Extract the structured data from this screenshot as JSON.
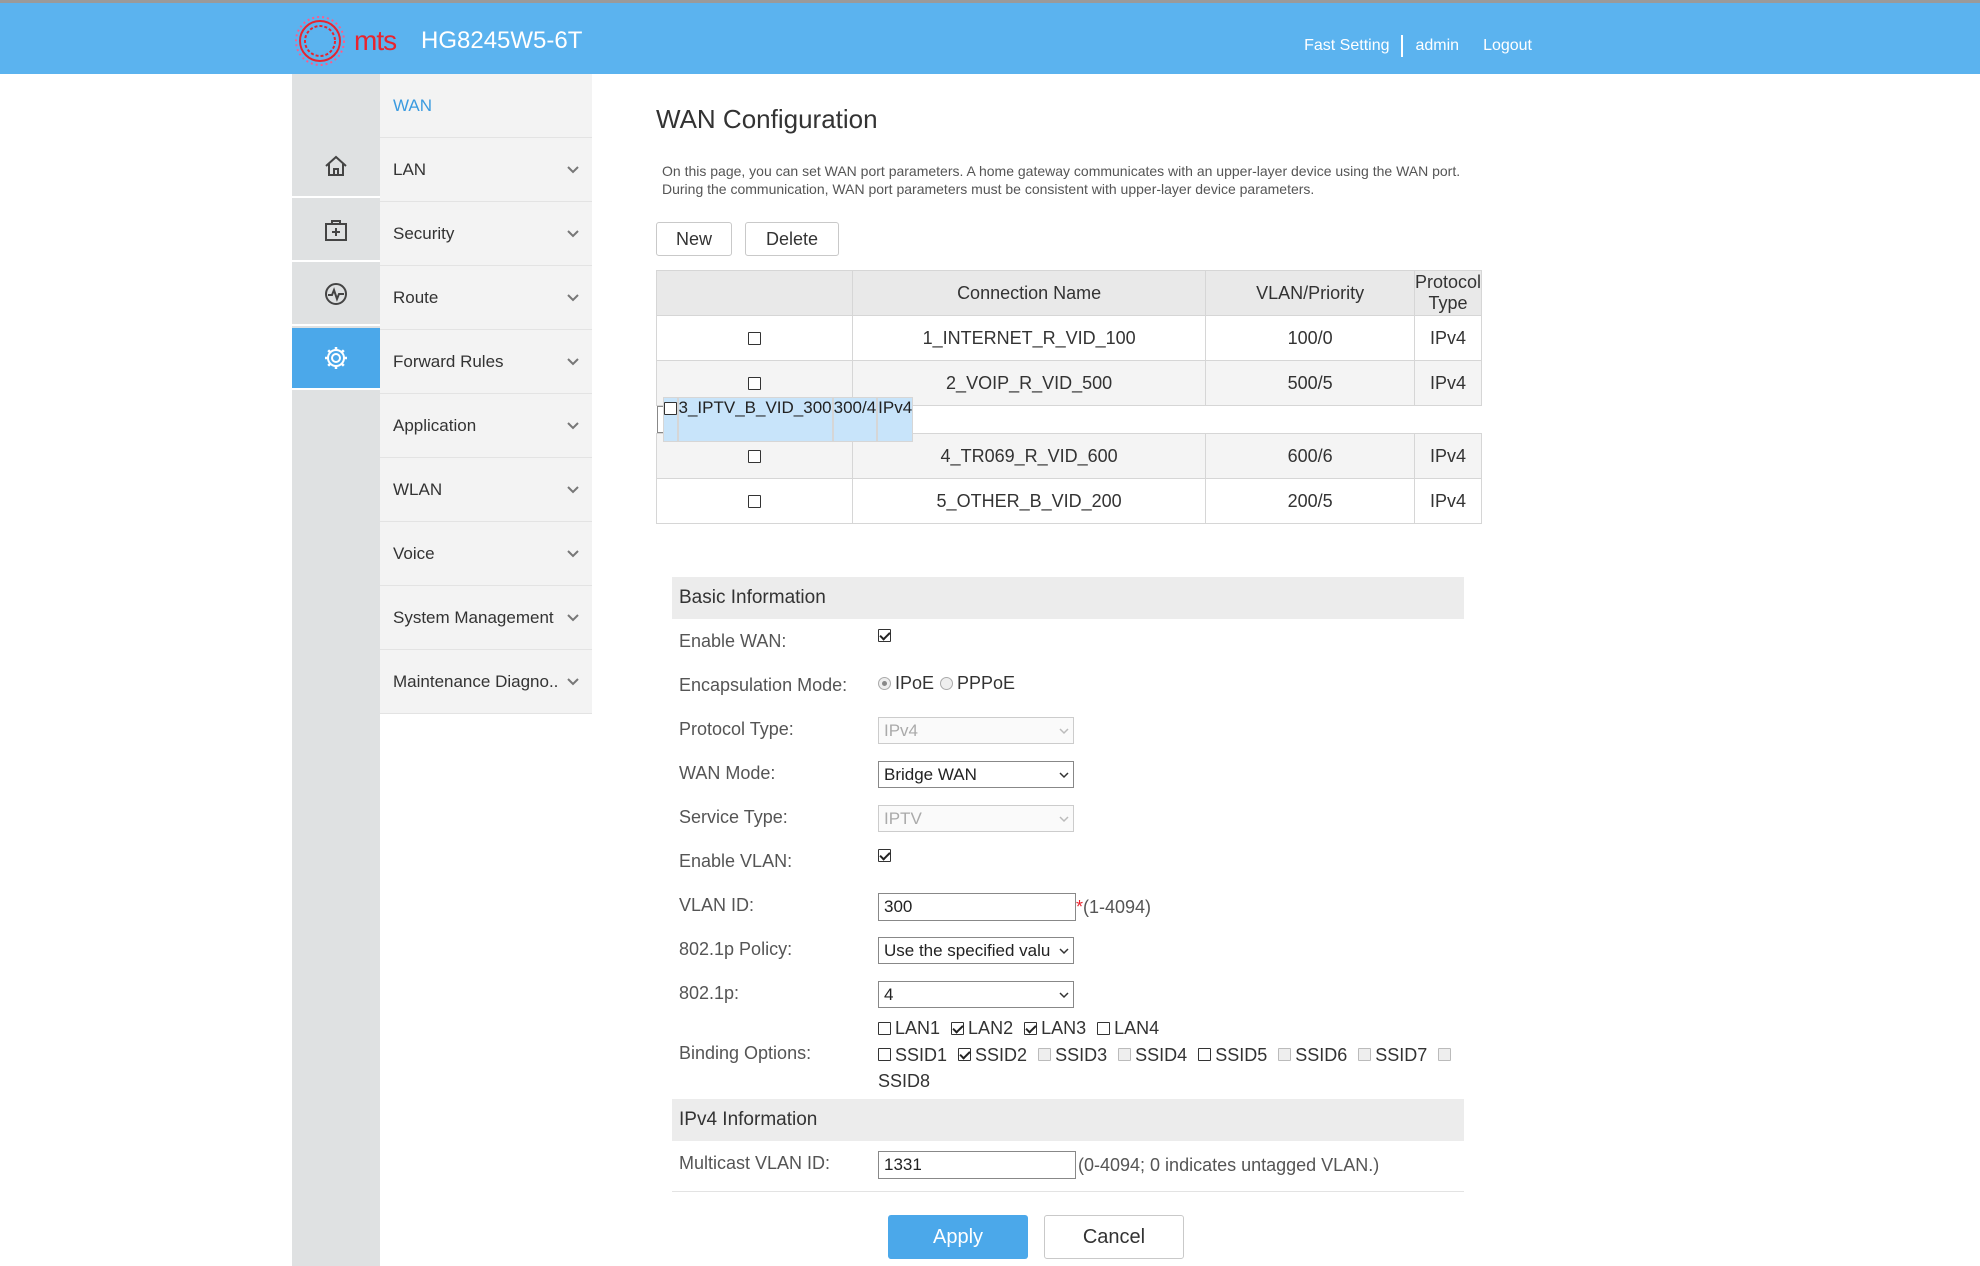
{
  "header": {
    "brand": "mts",
    "model": "HG8245W5-6T",
    "links": [
      "Fast Setting",
      "admin",
      "Logout"
    ]
  },
  "rail": {
    "icons": [
      "home-icon",
      "medical-kit-icon",
      "diagnostics-icon",
      "gear-icon"
    ],
    "active_index": 3
  },
  "menu": {
    "items": [
      {
        "label": "WAN"
      },
      {
        "label": "LAN"
      },
      {
        "label": "Security"
      },
      {
        "label": "Route"
      },
      {
        "label": "Forward Rules"
      },
      {
        "label": "Application"
      },
      {
        "label": "WLAN"
      },
      {
        "label": "Voice"
      },
      {
        "label": "System Management"
      },
      {
        "label": "Maintenance Diagno.."
      }
    ]
  },
  "page": {
    "title": "WAN Configuration",
    "description": "On this page, you can set WAN port parameters. A home gateway communicates with an upper-layer device using the WAN port. During the communication, WAN port parameters must be consistent with upper-layer device parameters.",
    "new_label": "New",
    "delete_label": "Delete"
  },
  "table": {
    "headers": [
      "Connection Name",
      "VLAN/Priority",
      "Protocol Type"
    ],
    "rows": [
      {
        "name": "1_INTERNET_R_VID_100",
        "vlan": "100/0",
        "protocol": "IPv4"
      },
      {
        "name": "2_VOIP_R_VID_500",
        "vlan": "500/5",
        "protocol": "IPv4"
      },
      {
        "name": "3_IPTV_B_VID_300",
        "vlan": "300/4",
        "protocol": "IPv4"
      },
      {
        "name": "4_TR069_R_VID_600",
        "vlan": "600/6",
        "protocol": "IPv4"
      },
      {
        "name": "5_OTHER_B_VID_200",
        "vlan": "200/5",
        "protocol": "IPv4"
      }
    ],
    "selected_row": 2
  },
  "form": {
    "basic_title": "Basic Information",
    "enable_wan_label": "Enable WAN:",
    "encap_label": "Encapsulation Mode:",
    "encap_opt1": "IPoE",
    "encap_opt2": "PPPoE",
    "protocol_label": "Protocol Type:",
    "protocol_value": "IPv4",
    "wan_mode_label": "WAN Mode:",
    "wan_mode_value": "Bridge WAN",
    "service_label": "Service Type:",
    "service_value": "IPTV",
    "enable_vlan_label": "Enable VLAN:",
    "vlan_id_label": "VLAN ID:",
    "vlan_id_value": "300",
    "vlan_id_req": "*",
    "vlan_id_hint": "(1-4094)",
    "policy_label": "802.1p Policy:",
    "policy_value": "Use the specified valu",
    "p_label": "802.1p:",
    "p_value": "4",
    "binding_label": "Binding Options:",
    "lan_opts": [
      {
        "label": "LAN1",
        "checked": false
      },
      {
        "label": "LAN2",
        "checked": true
      },
      {
        "label": "LAN3",
        "checked": true
      },
      {
        "label": "LAN4",
        "checked": false
      }
    ],
    "ssid_opts": [
      {
        "label": "SSID1",
        "checked": false,
        "disabled": false
      },
      {
        "label": "SSID2",
        "checked": true,
        "disabled": false
      },
      {
        "label": "SSID3",
        "checked": false,
        "disabled": true
      },
      {
        "label": "SSID4",
        "checked": false,
        "disabled": true
      },
      {
        "label": "SSID5",
        "checked": false,
        "disabled": false
      },
      {
        "label": "SSID6",
        "checked": false,
        "disabled": true
      },
      {
        "label": "SSID7",
        "checked": false,
        "disabled": true
      },
      {
        "label": "SSID8",
        "checked": false,
        "disabled": true
      }
    ],
    "ipv4_title": "IPv4 Information",
    "mcast_label": "Multicast VLAN ID:",
    "mcast_value": "1331",
    "mcast_hint": "(0-4094; 0 indicates untagged VLAN.)"
  },
  "actions": {
    "apply_label": "Apply",
    "cancel_label": "Cancel"
  }
}
